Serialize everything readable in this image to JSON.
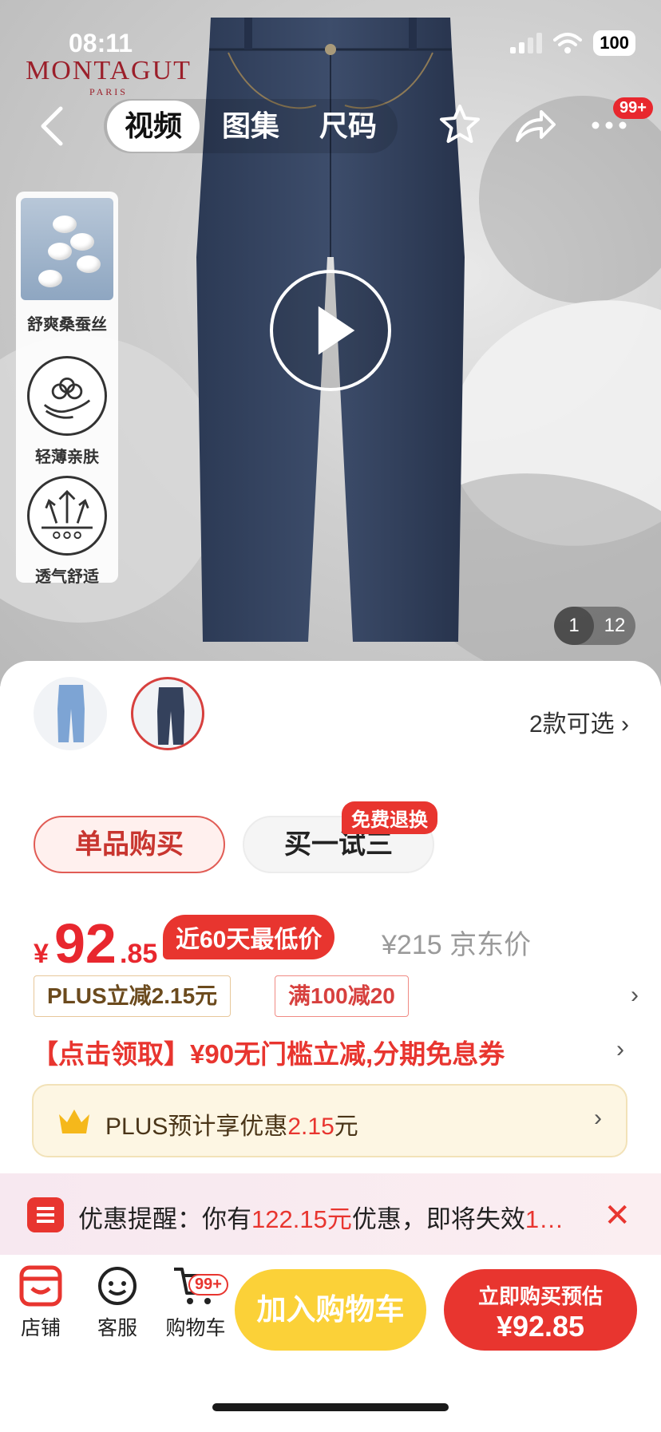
{
  "status_bar": {
    "time": "08:11",
    "battery": "100"
  },
  "brand": {
    "name": "MONTAGUT",
    "sub": "PARIS"
  },
  "nav": {
    "tabs": [
      {
        "label": "视频",
        "active": true
      },
      {
        "label": "图集",
        "active": false
      },
      {
        "label": "尺码",
        "active": false
      }
    ],
    "more_badge": "99+"
  },
  "features": [
    {
      "label": "舒爽桑蚕丝",
      "icon": "silk-cocoon-icon"
    },
    {
      "label": "轻薄亲肤",
      "icon": "cotton-hand-icon"
    },
    {
      "label": "透气舒适",
      "icon": "breathable-arrows-icon"
    }
  ],
  "gallery": {
    "current": "1",
    "total": "12"
  },
  "variants": {
    "label": "2款可选"
  },
  "buy_mode": {
    "single": "单品购买",
    "try": "买一试三",
    "try_badge": "免费退换"
  },
  "price": {
    "currency": "¥",
    "integer": "92",
    "decimal": ".85",
    "lowest_tag": "近60天最低价",
    "jd_price": "¥215 京东价"
  },
  "coupons": {
    "plus": "PLUS立减2.15元",
    "full": "满100减20"
  },
  "promo": {
    "text": "【点击领取】¥90无门槛立减,分期免息券"
  },
  "plus_box": {
    "prefix": "PLUS预计享优惠",
    "amount": "2.15",
    "suffix": "元"
  },
  "reminder": {
    "prefix": "优惠提醒：你有",
    "amount": "122.15元",
    "middle": "优惠，即将失效",
    "tail": "1…"
  },
  "bottom_bar": {
    "shop": "店铺",
    "service": "客服",
    "cart": "购物车",
    "cart_badge": "99+",
    "add_to_cart": "加入购物车",
    "buy_now_line1": "立即购买预估",
    "buy_now_line2": "¥92.85"
  },
  "colors": {
    "accent_red": "#e8352f",
    "cart_yellow": "#fbd138",
    "plus_gold": "#fdf6e3",
    "brand_red": "#9b1f2a"
  }
}
